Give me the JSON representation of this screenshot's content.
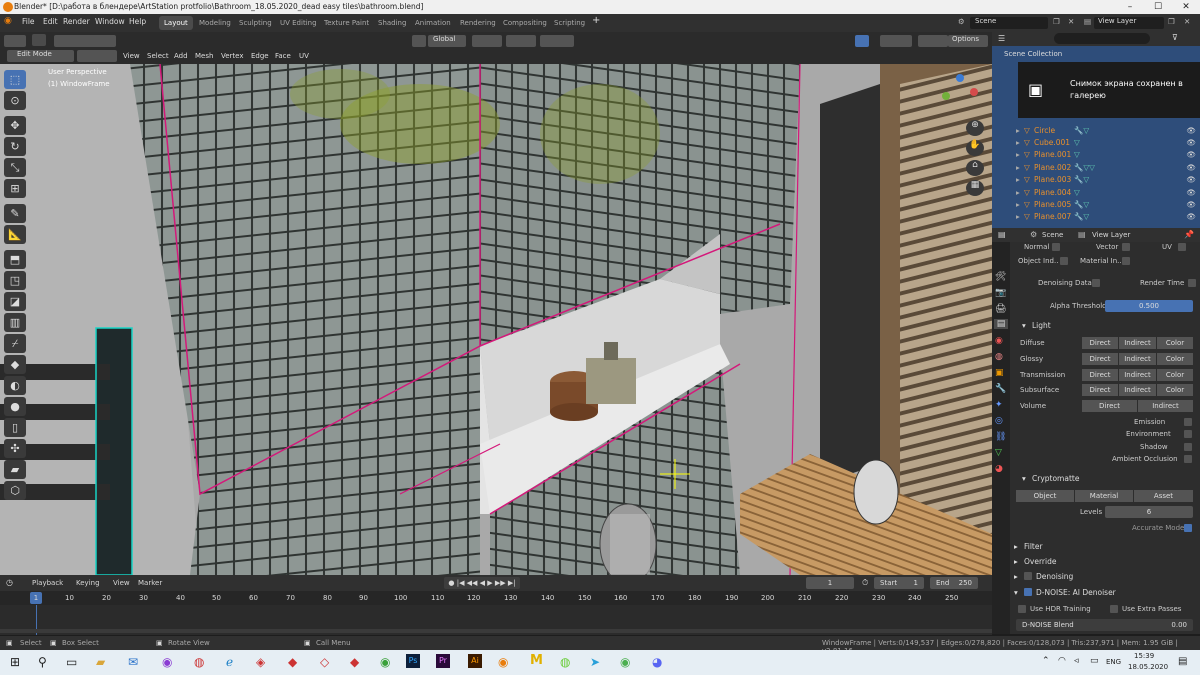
{
  "window": {
    "title": "Blender* [D:\\работа в блендере\\ArtStation protfolio\\Bathroom_18.05.2020_dead easy tiles\\bathroom.blend]"
  },
  "menus": [
    "File",
    "Edit",
    "Render",
    "Window",
    "Help"
  ],
  "workspaces": [
    "Layout",
    "Modeling",
    "Sculpting",
    "UV Editing",
    "Texture Paint",
    "Shading",
    "Animation",
    "Rendering",
    "Compositing",
    "Scripting"
  ],
  "active_workspace": "Layout",
  "scene": "Scene",
  "view_layer": "View Layer",
  "viewport_header": {
    "mode": "Edit Mode",
    "menus": [
      "View",
      "Select",
      "Add",
      "Mesh",
      "Vertex",
      "Edge",
      "Face",
      "UV"
    ],
    "orientation": "Global",
    "options": "Options"
  },
  "viewport": {
    "overlay_line1": "User Perspective",
    "overlay_line2": "(1) WindowFrame"
  },
  "outliner": {
    "title": "Scene Collection",
    "toast": "Снимок экрана сохранен в галерею",
    "items": [
      "Circle",
      "Cube.001",
      "Plane.001",
      "Plane.002",
      "Plane.003",
      "Plane.004",
      "Plane.005",
      "Plane.007"
    ]
  },
  "properties": {
    "header_scene": "Scene",
    "header_view_layer": "View Layer",
    "passes_row1": [
      "Normal",
      "Vector",
      "UV"
    ],
    "passes_row2": [
      "Object Ind..",
      "Material In.."
    ],
    "denoising_data": "Denoising Data",
    "render_time": "Render Time",
    "alpha_threshold_label": "Alpha Threshold",
    "alpha_threshold_value": "0.500",
    "light": {
      "title": "Light",
      "rows": [
        {
          "label": "Diffuse",
          "b1": "Direct",
          "b2": "Indirect",
          "b3": "Color"
        },
        {
          "label": "Glossy",
          "b1": "Direct",
          "b2": "Indirect",
          "b3": "Color"
        },
        {
          "label": "Transmission",
          "b1": "Direct",
          "b2": "Indirect",
          "b3": "Color"
        },
        {
          "label": "Subsurface",
          "b1": "Direct",
          "b2": "Indirect",
          "b3": "Color"
        }
      ],
      "volume": {
        "label": "Volume",
        "b1": "Direct",
        "b2": "Indirect"
      },
      "checks": [
        "Emission",
        "Environment",
        "Shadow",
        "Ambient Occlusion"
      ]
    },
    "cryptomatte": {
      "title": "Cryptomatte",
      "buttons": [
        "Object",
        "Material",
        "Asset"
      ],
      "levels_label": "Levels",
      "levels_value": "6",
      "accurate_mode": "Accurate Mode"
    },
    "filter": "Filter",
    "override": "Override",
    "denoising": "Denoising",
    "dnoise": "D-NOISE: AI Denoiser",
    "use_hdr": "Use HDR Training",
    "use_extra": "Use Extra Passes",
    "dnoise_blend_label": "D-NOISE Blend",
    "dnoise_blend_value": "0.00"
  },
  "timeline": {
    "menus": [
      "Playback",
      "Keying",
      "View",
      "Marker"
    ],
    "current_frame": "1",
    "start_label": "Start",
    "start_value": "1",
    "end_label": "End",
    "end_value": "250",
    "ruler": [
      "1",
      "10",
      "20",
      "30",
      "40",
      "50",
      "60",
      "70",
      "80",
      "90",
      "100",
      "110",
      "120",
      "130",
      "140",
      "150",
      "160",
      "170",
      "180",
      "190",
      "200",
      "210",
      "220",
      "230",
      "240",
      "250"
    ]
  },
  "statusbar": {
    "select": "Select",
    "box_select": "Box Select",
    "rotate_view": "Rotate View",
    "call_menu": "Call Menu",
    "stats": "WindowFrame | Verts:0/149,537 | Edges:0/278,820 | Faces:0/128,073 | Tris:237,971 | Mem: 1.95 GiB | v2.81.16"
  },
  "taskbar": {
    "lang": "ENG",
    "time": "15:39",
    "date": "18.05.2020"
  },
  "colors": {
    "accent": "#4772b3",
    "edge_select": "#d4187a",
    "outliner_object": "#e8902c",
    "toast_bg": "#1b1b1b"
  }
}
